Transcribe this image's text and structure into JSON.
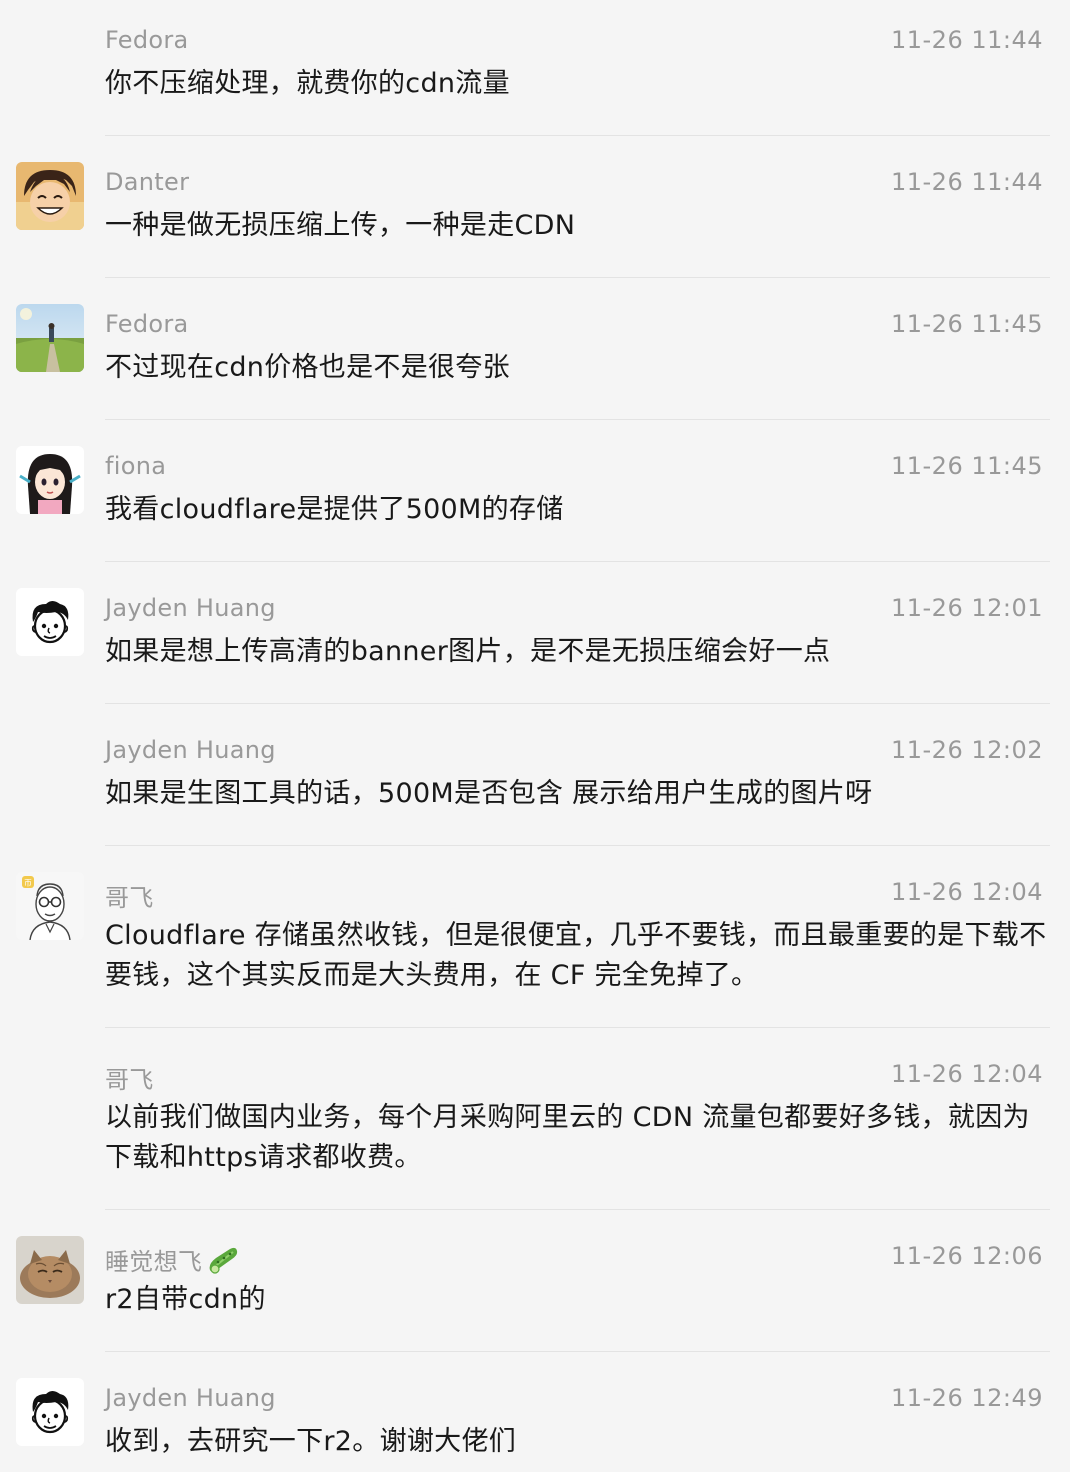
{
  "messages": [
    {
      "sender": "Fedora",
      "time": "11-26 11:44",
      "text": "你不压缩处理，就费你的cdn流量",
      "avatar": "none"
    },
    {
      "sender": "Danter",
      "time": "11-26 11:44",
      "text": "一种是做无损压缩上传，一种是走CDN",
      "avatar": "anime-boy-avatar"
    },
    {
      "sender": "Fedora",
      "time": "11-26 11:45",
      "text": "不过现在cdn价格也是不是很夸张",
      "avatar": "landscape-avatar"
    },
    {
      "sender": "fiona",
      "time": "11-26 11:45",
      "text": "我看cloudflare是提供了500M的存储",
      "avatar": "anime-girl-avatar"
    },
    {
      "sender": "Jayden Huang",
      "time": "11-26 12:01",
      "text": "如果是想上传高清的banner图片，是不是无损压缩会好一点",
      "avatar": "cartoon-face-avatar"
    },
    {
      "sender": "Jayden Huang",
      "time": "11-26 12:02",
      "text": "如果是生图工具的话，500M是否包含 展示给用户生成的图片呀",
      "avatar": "none"
    },
    {
      "sender": "哥飞",
      "time": "11-26 12:04",
      "text": "Cloudflare 存储虽然收钱，但是很便宜，几乎不要钱，而且最重要的是下载不要钱，这个其实反而是大头费用，在 CF 完全免掉了。",
      "avatar": "glasses-man-avatar"
    },
    {
      "sender": "哥飞",
      "time": "11-26 12:04",
      "text": "以前我们做国内业务，每个月采购阿里云的 CDN 流量包都要好多钱，就因为下载和https请求都收费。",
      "avatar": "none"
    },
    {
      "sender": "睡觉想飞",
      "time": "11-26 12:06",
      "text": "r2自带cdn的",
      "avatar": "cat-avatar",
      "emoji": "cucumber-icon"
    },
    {
      "sender": "Jayden Huang",
      "time": "11-26 12:49",
      "text": "收到，去研究一下r2。谢谢大佬们",
      "avatar": "cartoon-face-avatar"
    }
  ]
}
